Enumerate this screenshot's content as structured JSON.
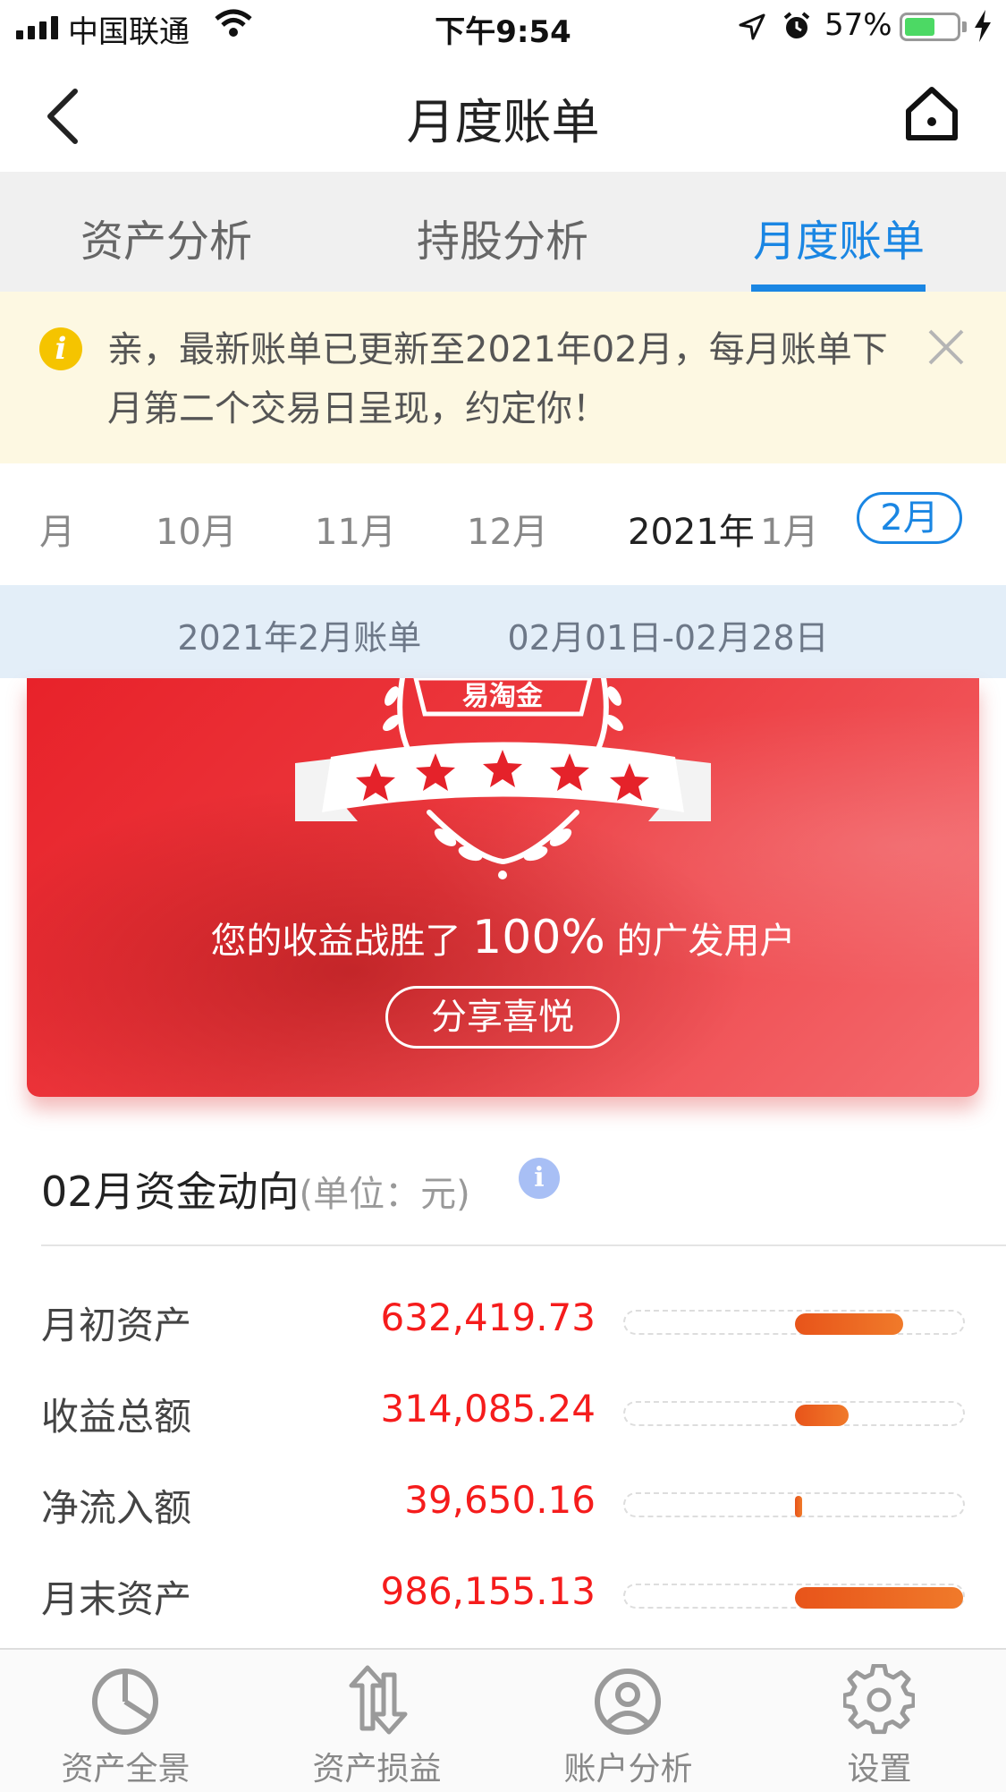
{
  "status_bar": {
    "carrier": "中国联通",
    "time": "下午9:54",
    "battery_percent_text": "57%",
    "battery_level": 0.57
  },
  "nav": {
    "title": "月度账单",
    "back_icon": "chevron-left-icon",
    "home_icon": "home-icon"
  },
  "tabs": [
    {
      "label": "资产分析",
      "active": false
    },
    {
      "label": "持股分析",
      "active": false
    },
    {
      "label": "月度账单",
      "active": true
    }
  ],
  "notice": {
    "text": "亲，最新账单已更新至2021年02月，每月账单下月第二个交易日呈现，约定你！",
    "icon": "info-icon",
    "close_icon": "close-icon"
  },
  "months": {
    "items": [
      "月",
      "10月",
      "11月",
      "12月"
    ],
    "year_label": "2021年",
    "year_month": "1月",
    "selected": "2月"
  },
  "period": {
    "bill": "2021年2月账单",
    "range": "02月01日-02月28日"
  },
  "banner": {
    "brand": "易淘金",
    "stars": 5,
    "headline_prefix": "您的收益战胜了",
    "headline_percent": "100%",
    "headline_suffix": "的广发用户",
    "share_label": "分享喜悦"
  },
  "fund_flow": {
    "title": "02月资金动向",
    "unit": "(单位：元)",
    "info_icon": "info-icon",
    "rows": [
      {
        "label": "月初资产",
        "value": "632,419.73",
        "amount": 632419.73
      },
      {
        "label": "收益总额",
        "value": "314,085.24",
        "amount": 314085.24
      },
      {
        "label": "净流入额",
        "value": "39,650.16",
        "amount": 39650.16
      },
      {
        "label": "月末资产",
        "value": "986,155.13",
        "amount": 986155.13
      }
    ]
  },
  "tabbar": [
    {
      "label": "资产全景",
      "icon": "pie-chart-icon"
    },
    {
      "label": "资产损益",
      "icon": "up-down-arrows-icon"
    },
    {
      "label": "账户分析",
      "icon": "user-icon"
    },
    {
      "label": "设置",
      "icon": "gear-icon"
    }
  ]
}
